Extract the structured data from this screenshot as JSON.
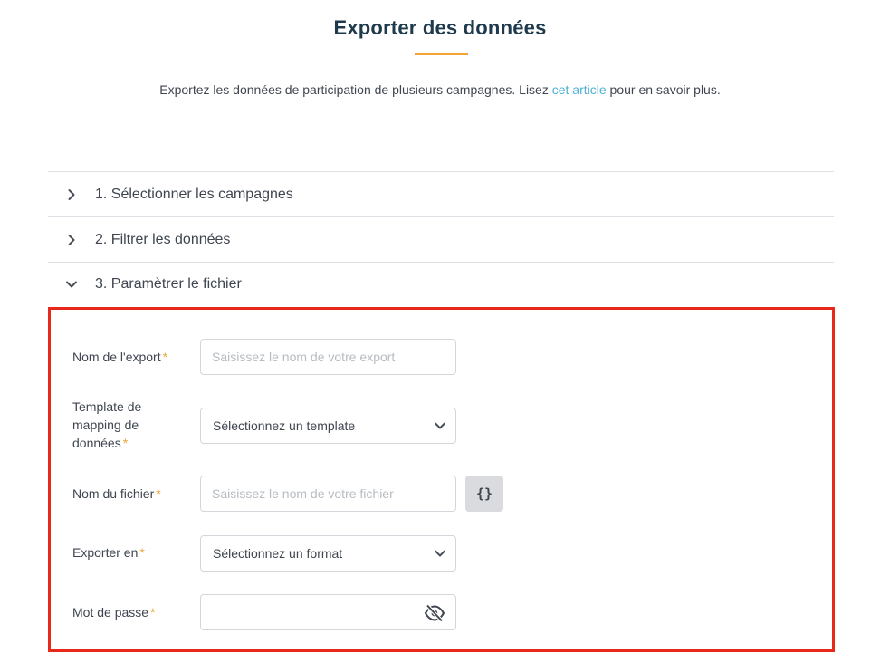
{
  "header": {
    "title": "Exporter des données",
    "intro_before": "Exportez les données de participation de plusieurs campagnes. Lisez ",
    "intro_link": "cet article",
    "intro_after": " pour en savoir plus."
  },
  "steps": [
    {
      "label": "1. Sélectionner les campagnes",
      "expanded": false,
      "icon": "chevron-right-icon"
    },
    {
      "label": "2. Filtrer les données",
      "expanded": false,
      "icon": "chevron-right-icon"
    },
    {
      "label": "3. Paramètrer le fichier",
      "expanded": true,
      "icon": "chevron-down-icon"
    }
  ],
  "form": {
    "export_name": {
      "label": "Nom de l'export",
      "required_mark": "*",
      "placeholder": "Saisissez le nom de votre export",
      "value": ""
    },
    "template": {
      "label_lines": [
        "Template de",
        "mapping de",
        "données"
      ],
      "required_mark": "*",
      "selected": "Sélectionnez un template"
    },
    "file_name": {
      "label": "Nom du fichier",
      "required_mark": "*",
      "placeholder": "Saisissez le nom de votre fichier",
      "value": "",
      "variable_button": "{}"
    },
    "format": {
      "label": "Exporter en",
      "required_mark": "*",
      "selected": "Sélectionnez un format"
    },
    "password": {
      "label": "Mot de passe",
      "required_mark": "*",
      "value": "",
      "toggle_icon": "eye-off-icon"
    }
  },
  "colors": {
    "accent": "#f0a436",
    "link": "#4fb0d6",
    "highlight_border": "#e8281b",
    "title": "#1e3a4c"
  }
}
